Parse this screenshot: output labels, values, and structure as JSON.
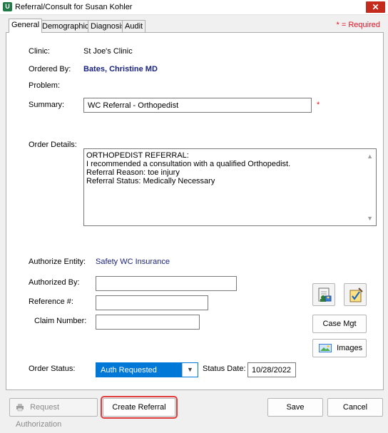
{
  "window": {
    "title": "Referral/Consult for Susan Kohler",
    "close_glyph": "✕",
    "app_icon_letter": "U"
  },
  "tabs": [
    {
      "label": "General",
      "active": true
    },
    {
      "label": "Demographics",
      "active": false
    },
    {
      "label": "Diagnosis",
      "active": false
    },
    {
      "label": "Audit",
      "active": false
    }
  ],
  "required_note": "* = Required",
  "form": {
    "clinic": {
      "label": "Clinic:",
      "value": "St Joe's Clinic"
    },
    "ordered_by": {
      "label": "Ordered By:",
      "value": "Bates, Christine  MD"
    },
    "problem": {
      "label": "Problem:"
    },
    "summary": {
      "label": "Summary:",
      "value": "WC Referral - Orthopedist",
      "required_mark": "*"
    },
    "order_details": {
      "label": "Order Details:",
      "lines": [
        "ORTHOPEDIST REFERRAL:",
        "I recommended a consultation with a qualified Orthopedist.",
        "Referral Reason: toe injury",
        "Referral Status: Medically Necessary"
      ]
    },
    "authorize_entity": {
      "label": "Authorize Entity:",
      "value": "Safety WC Insurance"
    },
    "authorized_by": {
      "label": "Authorized By:",
      "value": ""
    },
    "reference": {
      "label": "Reference #:",
      "value": ""
    },
    "claim_number": {
      "label": "Claim Number:",
      "value": ""
    },
    "order_status": {
      "label": "Order Status:",
      "value": "Auth Requested"
    },
    "status_date": {
      "label": "Status Date:",
      "value": "10/28/2022"
    }
  },
  "side_buttons": {
    "case_mgt": "Case Mgt",
    "images": "Images"
  },
  "footer": {
    "request_authorization": "Request Authorization",
    "create_referral": "Create Referral",
    "save": "Save",
    "cancel": "Cancel"
  },
  "colors": {
    "accent": "#0078d7",
    "required": "#e81123",
    "highlight": "#e03c3c",
    "value_text": "#1a237e"
  }
}
